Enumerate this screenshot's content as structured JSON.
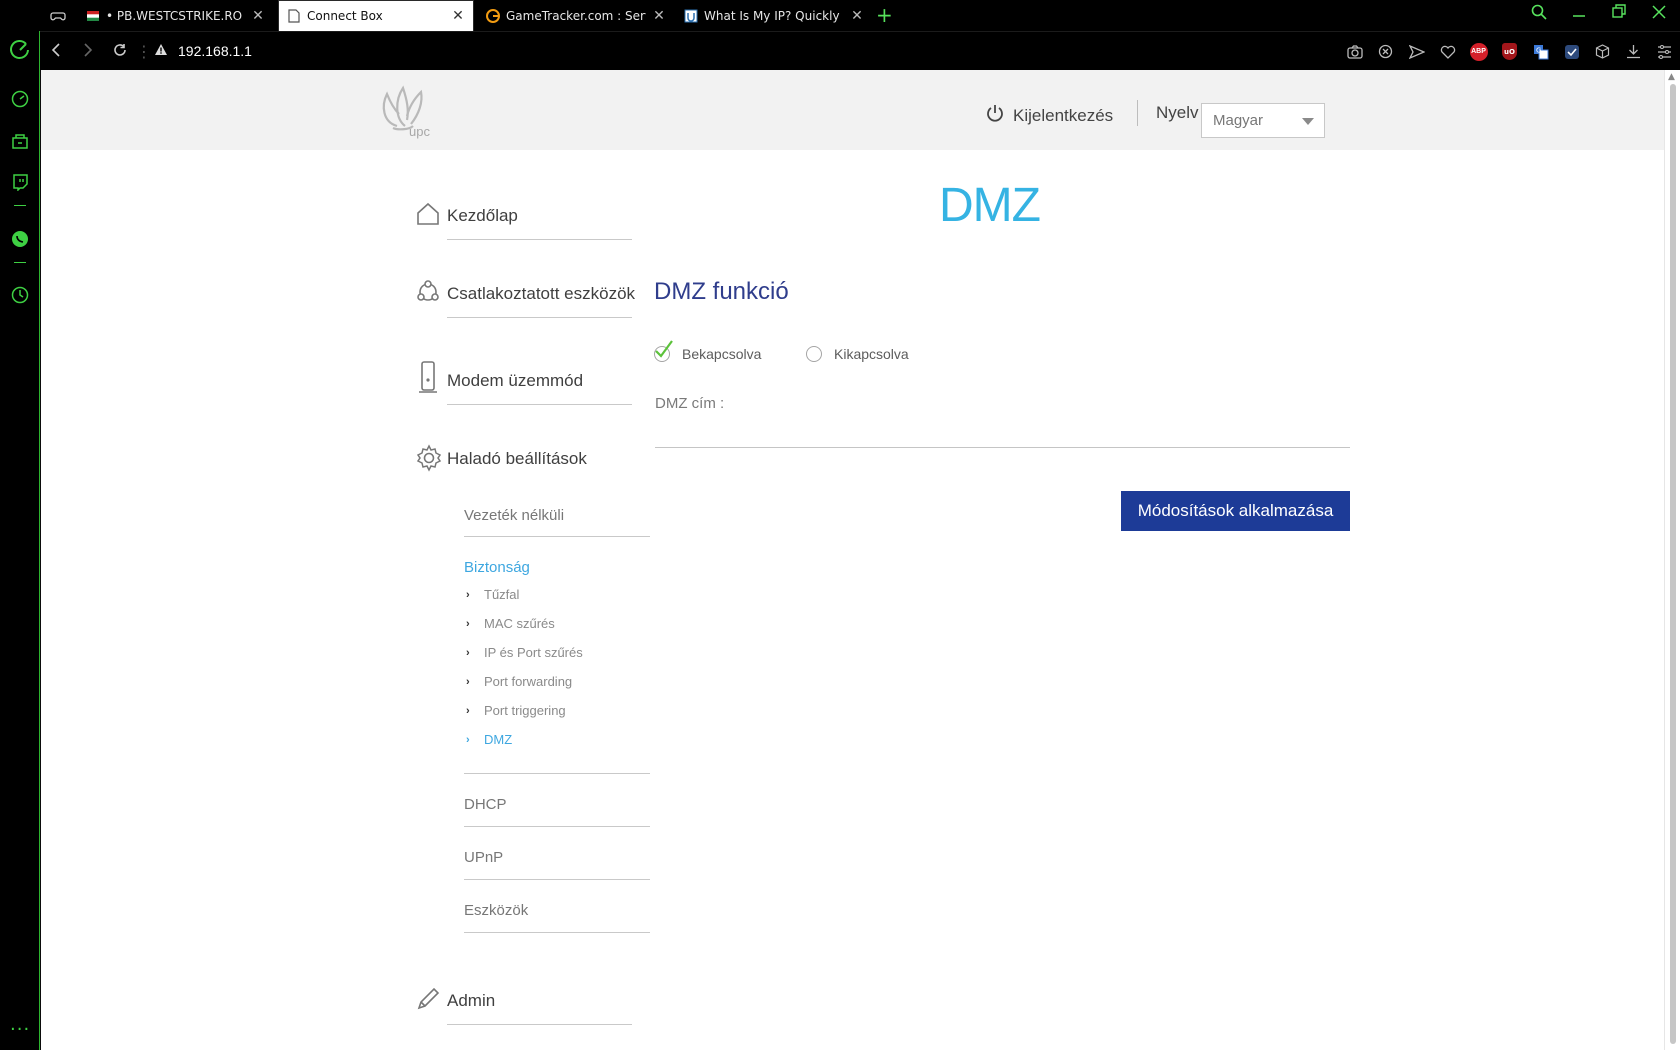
{
  "browser": {
    "tabs": [
      {
        "label": "• PB.WESTCSTRIKE.RO @ Pl",
        "icon": "flag-favicon-icon",
        "active": false
      },
      {
        "label": "Connect Box",
        "icon": "document-icon",
        "active": true
      },
      {
        "label": "GameTracker.com : Servers",
        "icon": "gametracker-favicon-icon",
        "active": false
      },
      {
        "label": "What Is My IP? Quickly See",
        "icon": "whatismyip-favicon-icon",
        "active": false
      }
    ],
    "new_tab": "+",
    "url": "192.168.1.1",
    "extensions": {
      "abp": "ABP",
      "ublock": "uO"
    },
    "accent_color": "#3ed043"
  },
  "header": {
    "logo_text": "upc",
    "logout_label": "Kijelentkezés",
    "language_label": "Nyelv",
    "language_value": "Magyar"
  },
  "nav": {
    "home": "Kezdőlap",
    "devices": "Csatlakoztatott eszközök",
    "modem_mode": "Modem üzemmód",
    "advanced": "Haladó beállítások",
    "wireless": "Vezeték nélküli",
    "security": "Biztonság",
    "security_items": [
      "Tűzfal",
      "MAC szűrés",
      "IP és Port szűrés",
      "Port forwarding",
      "Port triggering",
      "DMZ"
    ],
    "dhcp": "DHCP",
    "upnp": "UPnP",
    "tools": "Eszközök",
    "admin": "Admin"
  },
  "content": {
    "page_title": "DMZ",
    "section_title": "DMZ funkció",
    "radio_on": "Bekapcsolva",
    "radio_off": "Kikapcsolva",
    "radio_selected": "on",
    "dmz_address_label": "DMZ cím  :",
    "dmz_address_value": "",
    "apply_button": "Módosítások alkalmazása"
  },
  "colors": {
    "title_blue": "#35b3e3",
    "section_blue": "#2f3d8c",
    "button_blue": "#1d3b97",
    "active_link": "#3ea7e0",
    "check_green": "#5cc23b"
  }
}
